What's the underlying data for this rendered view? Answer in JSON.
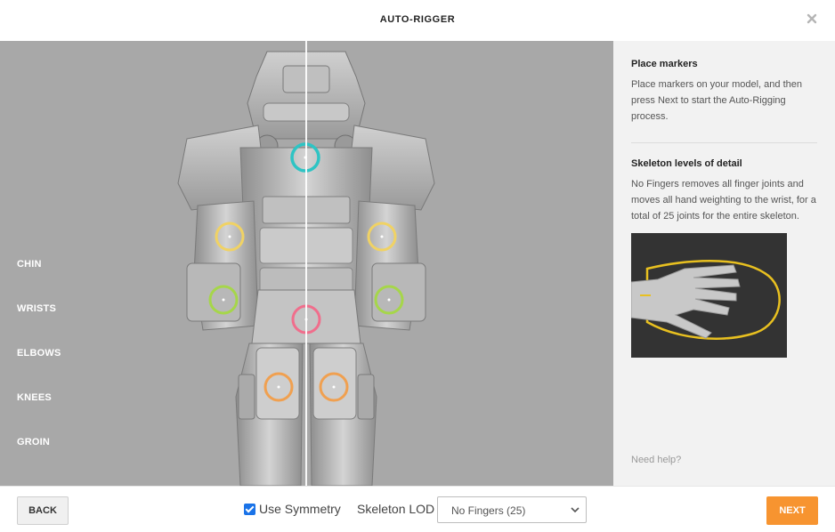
{
  "header": {
    "title": "AUTO-RIGGER",
    "close_icon": "close-icon"
  },
  "viewport": {
    "marker_labels": [
      "CHIN",
      "WRISTS",
      "ELBOWS",
      "KNEES",
      "GROIN"
    ],
    "marker_colors": {
      "chin": "#2ec4c4",
      "elbows": "#f0d264",
      "wrists": "#a6d64a",
      "groin": "#f06e8c",
      "knees": "#f0a050"
    }
  },
  "panel": {
    "place_title": "Place markers",
    "place_text": "Place markers on your model, and then press Next to start the Auto-Rigging process.",
    "lod_title": "Skeleton levels of detail",
    "lod_text": "No Fingers removes all finger joints and moves all hand weighting to the wrist, for a total of 25 joints for the entire skeleton.",
    "help_link": "Need help?"
  },
  "footer": {
    "back_label": "BACK",
    "symmetry_label": "Use Symmetry",
    "symmetry_checked": true,
    "lod_label": "Skeleton LOD",
    "lod_value": "No Fingers (25)",
    "next_label": "NEXT"
  },
  "colors": {
    "accent": "#f79430",
    "viewport_bg": "#a8a8a8",
    "panel_bg": "#f2f2f2"
  }
}
